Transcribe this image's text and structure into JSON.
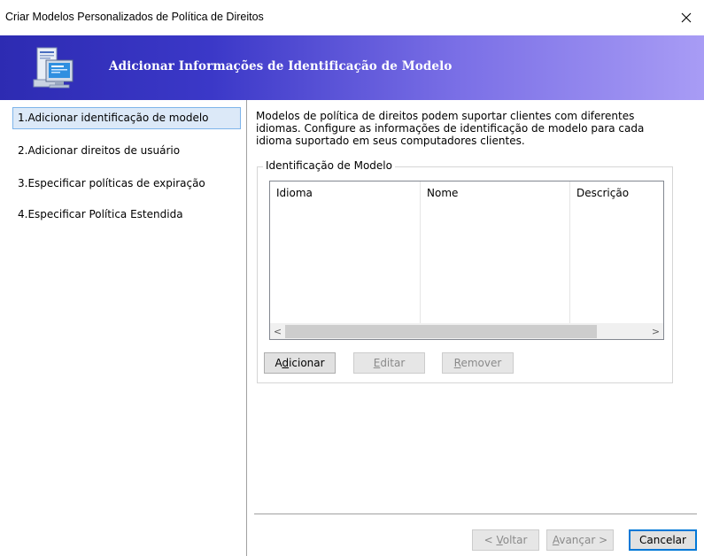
{
  "window": {
    "title": "Criar Modelos Personalizados de Política de Direitos",
    "close_glyph": "✕"
  },
  "banner": {
    "icon": "computer-document-icon",
    "heading": "Adicionar Informações de Identificação de Modelo",
    "gradient_start": "#2d2bb2",
    "gradient_end": "#a89cf5"
  },
  "sidebar": {
    "items": [
      {
        "label": "1.Adicionar identificação de modelo",
        "active": true
      },
      {
        "label": "2.Adicionar direitos de usuário",
        "active": false
      },
      {
        "label": "3.Especificar políticas de expiração",
        "active": false
      },
      {
        "label": "4.Especificar Política Estendida",
        "active": false
      }
    ]
  },
  "main": {
    "description": "Modelos de política de direitos podem suportar clientes com diferentes idiomas. Configure as informações de identificação de modelo para cada idioma suportado em seus computadores clientes.",
    "group_title": "Identificação de Modelo",
    "columns": [
      "Idioma",
      "Nome",
      "Descrição"
    ],
    "rows": [],
    "scroll_left": "<",
    "scroll_right": ">",
    "buttons": {
      "add": {
        "prefix": "A",
        "mnemonic": "d",
        "rest": "icionar",
        "enabled": true
      },
      "edit": {
        "prefix": "",
        "mnemonic": "E",
        "rest": "ditar",
        "enabled": false
      },
      "remove": {
        "prefix": "",
        "mnemonic": "R",
        "rest": "emover",
        "enabled": false
      }
    }
  },
  "footer": {
    "back": {
      "prefix": "< ",
      "mnemonic": "V",
      "rest": "oltar",
      "enabled": false
    },
    "next": {
      "prefix": "",
      "mnemonic": "A",
      "rest": "vançar >",
      "enabled": false
    },
    "cancel": {
      "label": "Cancelar",
      "enabled": true
    }
  },
  "colors": {
    "selection_bg": "#dce9f8",
    "selection_border": "#7eb4ea",
    "default_button_border": "#0078d7"
  }
}
